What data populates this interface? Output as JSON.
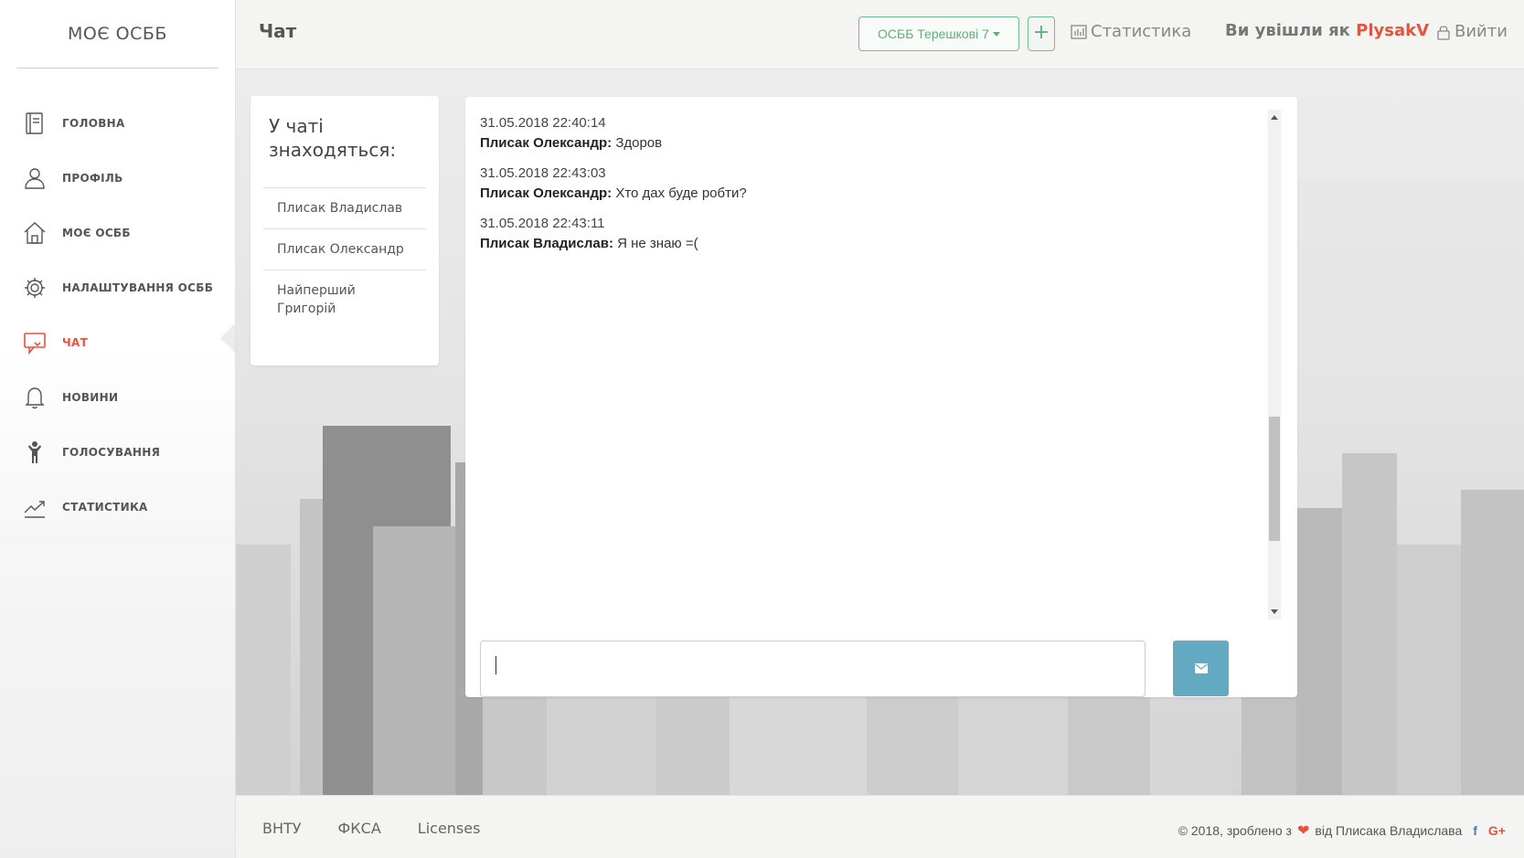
{
  "brand": "МОЄ ОСББ",
  "sidebar": {
    "items": [
      {
        "label": "ГОЛОВНА",
        "icon": "book-icon"
      },
      {
        "label": "ПРОФІЛЬ",
        "icon": "user-icon"
      },
      {
        "label": "МОЄ ОСББ",
        "icon": "home-icon"
      },
      {
        "label": "НАЛАШТУВАННЯ ОСББ",
        "icon": "gear-icon"
      },
      {
        "label": "ЧАТ",
        "icon": "chat-icon",
        "active": true
      },
      {
        "label": "НОВИНИ",
        "icon": "bell-icon"
      },
      {
        "label": "ГОЛОСУВАННЯ",
        "icon": "person-icon"
      },
      {
        "label": "СТАТИСТИКА",
        "icon": "trend-icon"
      }
    ]
  },
  "header": {
    "title": "Чат",
    "osbb_select": "ОСББ Терешкові 7",
    "add_label": "+",
    "stats_label": "Статистика",
    "logged_in_prefix": "Ви увішли як",
    "username": "PlysakV",
    "logout_label": "Вийти"
  },
  "users_panel": {
    "title": "У чаті знаходяться:",
    "users": [
      "Плисак Владислав",
      "Плисак Олександр",
      "Найперший Григорій"
    ]
  },
  "chat": {
    "messages": [
      {
        "time": "31.05.2018 22:40:14",
        "author": "Плисак Олександр:",
        "text": "Здоров"
      },
      {
        "time": "31.05.2018 22:43:03",
        "author": "Плисак Олександр:",
        "text": "Хто дах буде робти?"
      },
      {
        "time": "31.05.2018 22:43:11",
        "author": "Плисак Владислав:",
        "text": "Я не знаю =("
      }
    ],
    "input_value": ""
  },
  "footer": {
    "links": [
      "ВНТУ",
      "ФКСА",
      "Licenses"
    ],
    "copyright_prefix": "© 2018, зроблено з",
    "copyright_suffix": "від Плисака Владислава",
    "social": [
      "f",
      "G+"
    ]
  },
  "colors": {
    "accent": "#e5533d",
    "green": "#5cb07c",
    "send_button": "#64a9c2"
  }
}
